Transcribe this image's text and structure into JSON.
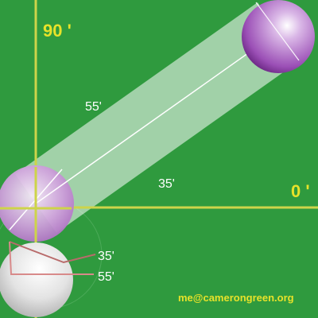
{
  "labels": {
    "angle_90": "90 '",
    "angle_0": "0 '",
    "path_angle_55": "55'",
    "path_angle_35": "35'",
    "cut_angle_35": "35'",
    "cut_angle_55": "55'",
    "credit": "me@camerongreen.org"
  },
  "colors": {
    "table": "#2f9a3e",
    "axis": "#cdd44a",
    "axis_text": "#e7e22a",
    "path_band": "#ffffff",
    "path_line": "#ffffff",
    "object_ball": "#8a3aa3",
    "cue_ball": "#dddddd",
    "angle_line": "#c98080"
  }
}
